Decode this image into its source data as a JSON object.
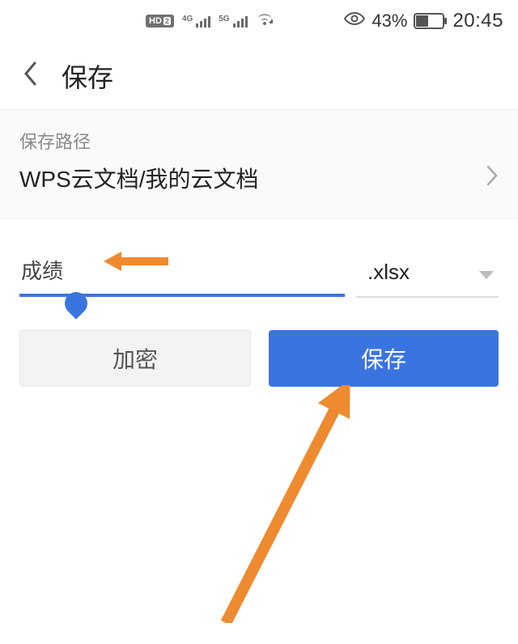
{
  "status": {
    "hd": "HD",
    "hd_num": "2",
    "net1": "4G",
    "net2": "5G",
    "battery_text": "43%",
    "time": "20:45"
  },
  "header": {
    "title": "保存"
  },
  "path": {
    "label": "保存路径",
    "value": "WPS云文档/我的云文档"
  },
  "filename": {
    "value": "成绩"
  },
  "extension": {
    "value": ".xlsx"
  },
  "buttons": {
    "encrypt": "加密",
    "save": "保存"
  }
}
